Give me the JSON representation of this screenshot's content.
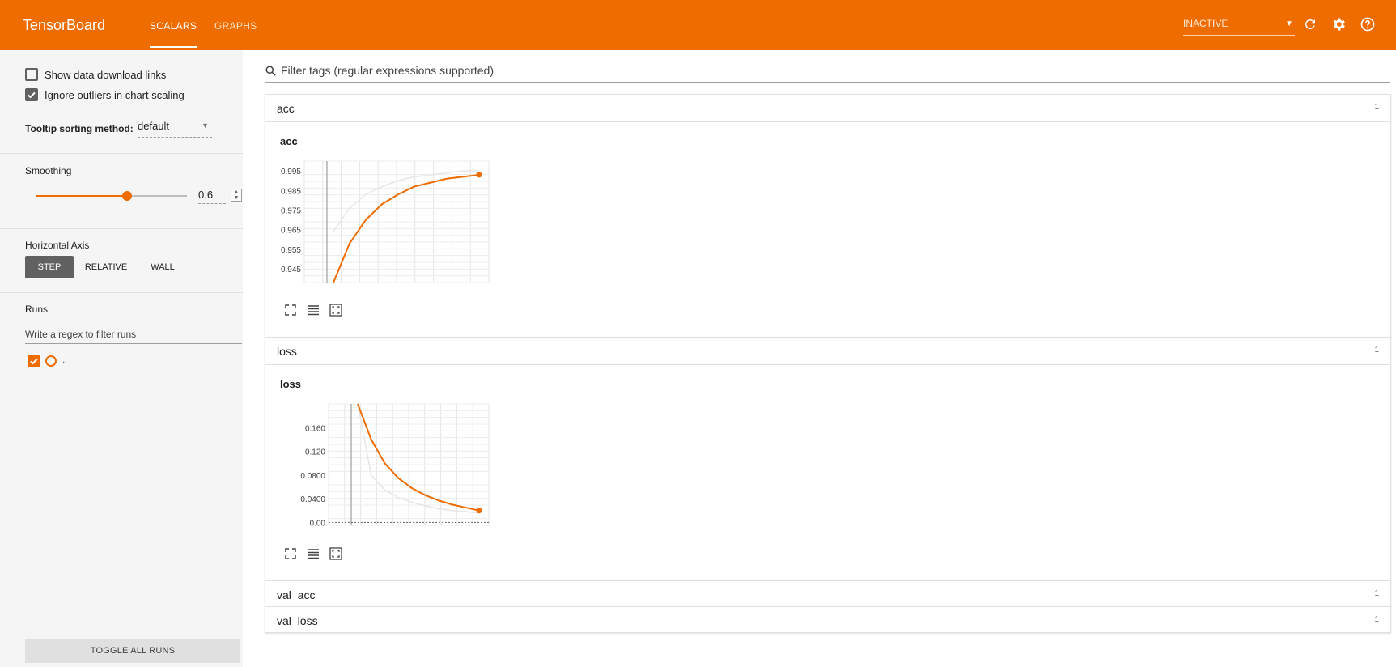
{
  "header": {
    "title": "TensorBoard",
    "tabs": [
      {
        "label": "SCALARS",
        "active": true
      },
      {
        "label": "GRAPHS",
        "active": false
      }
    ],
    "status_select": "INACTIVE",
    "icons": [
      "refresh-icon",
      "settings-gear-icon",
      "help-icon"
    ],
    "accent_color": "#ef6c00"
  },
  "sidebar": {
    "show_download_links": {
      "label": "Show data download links",
      "checked": false
    },
    "ignore_outliers": {
      "label": "Ignore outliers in chart scaling",
      "checked": true
    },
    "tooltip_sorting": {
      "label": "Tooltip sorting method:",
      "value": "default"
    },
    "smoothing": {
      "title": "Smoothing",
      "value": "0.6",
      "fraction": 0.6
    },
    "horizontal_axis": {
      "title": "Horizontal Axis",
      "options": [
        "STEP",
        "RELATIVE",
        "WALL"
      ],
      "selected": "STEP"
    },
    "runs": {
      "title": "Runs",
      "filter_placeholder": "Write a regex to filter runs",
      "items": [
        {
          "name": ".",
          "checked": true
        }
      ]
    },
    "toggle_all": "TOGGLE ALL RUNS"
  },
  "main": {
    "filter_placeholder": "Filter tags (regular expressions supported)",
    "categories": [
      {
        "name": "acc",
        "count": "1",
        "expanded": true
      },
      {
        "name": "loss",
        "count": "1",
        "expanded": true
      },
      {
        "name": "val_acc",
        "count": "1",
        "expanded": false
      },
      {
        "name": "val_loss",
        "count": "1",
        "expanded": false
      }
    ]
  },
  "chart_data": [
    {
      "type": "line",
      "title": "acc",
      "yticks": [
        "0.995",
        "0.985",
        "0.975",
        "0.965",
        "0.955",
        "0.945"
      ],
      "ylim": [
        0.938,
        1.0
      ],
      "x": [
        0,
        1,
        2,
        3,
        4,
        5,
        6,
        7,
        8,
        9
      ],
      "series": [
        {
          "values": [
            0.938,
            0.958,
            0.97,
            0.978,
            0.983,
            0.987,
            0.989,
            0.991,
            0.992,
            0.993
          ],
          "color": "#ef6c00"
        },
        {
          "values": [
            0.964,
            0.976,
            0.983,
            0.987,
            0.99,
            0.992,
            0.993,
            0.994,
            0.995,
            0.995
          ],
          "color": "#e6e6e6"
        }
      ],
      "grid": true
    },
    {
      "type": "line",
      "title": "loss",
      "yticks": [
        "0.160",
        "0.120",
        "0.0800",
        "0.0400",
        "0.00"
      ],
      "ylim": [
        -0.005,
        0.2
      ],
      "x": [
        0,
        1,
        2,
        3,
        4,
        5,
        6,
        7,
        8,
        9
      ],
      "series": [
        {
          "values": [
            0.2,
            0.14,
            0.1,
            0.075,
            0.058,
            0.046,
            0.037,
            0.03,
            0.025,
            0.02
          ],
          "color": "#ef6c00"
        },
        {
          "values": [
            0.2,
            0.08,
            0.055,
            0.042,
            0.034,
            0.028,
            0.023,
            0.02,
            0.018,
            0.016
          ],
          "color": "#e6e6e6"
        }
      ],
      "grid": true
    }
  ]
}
